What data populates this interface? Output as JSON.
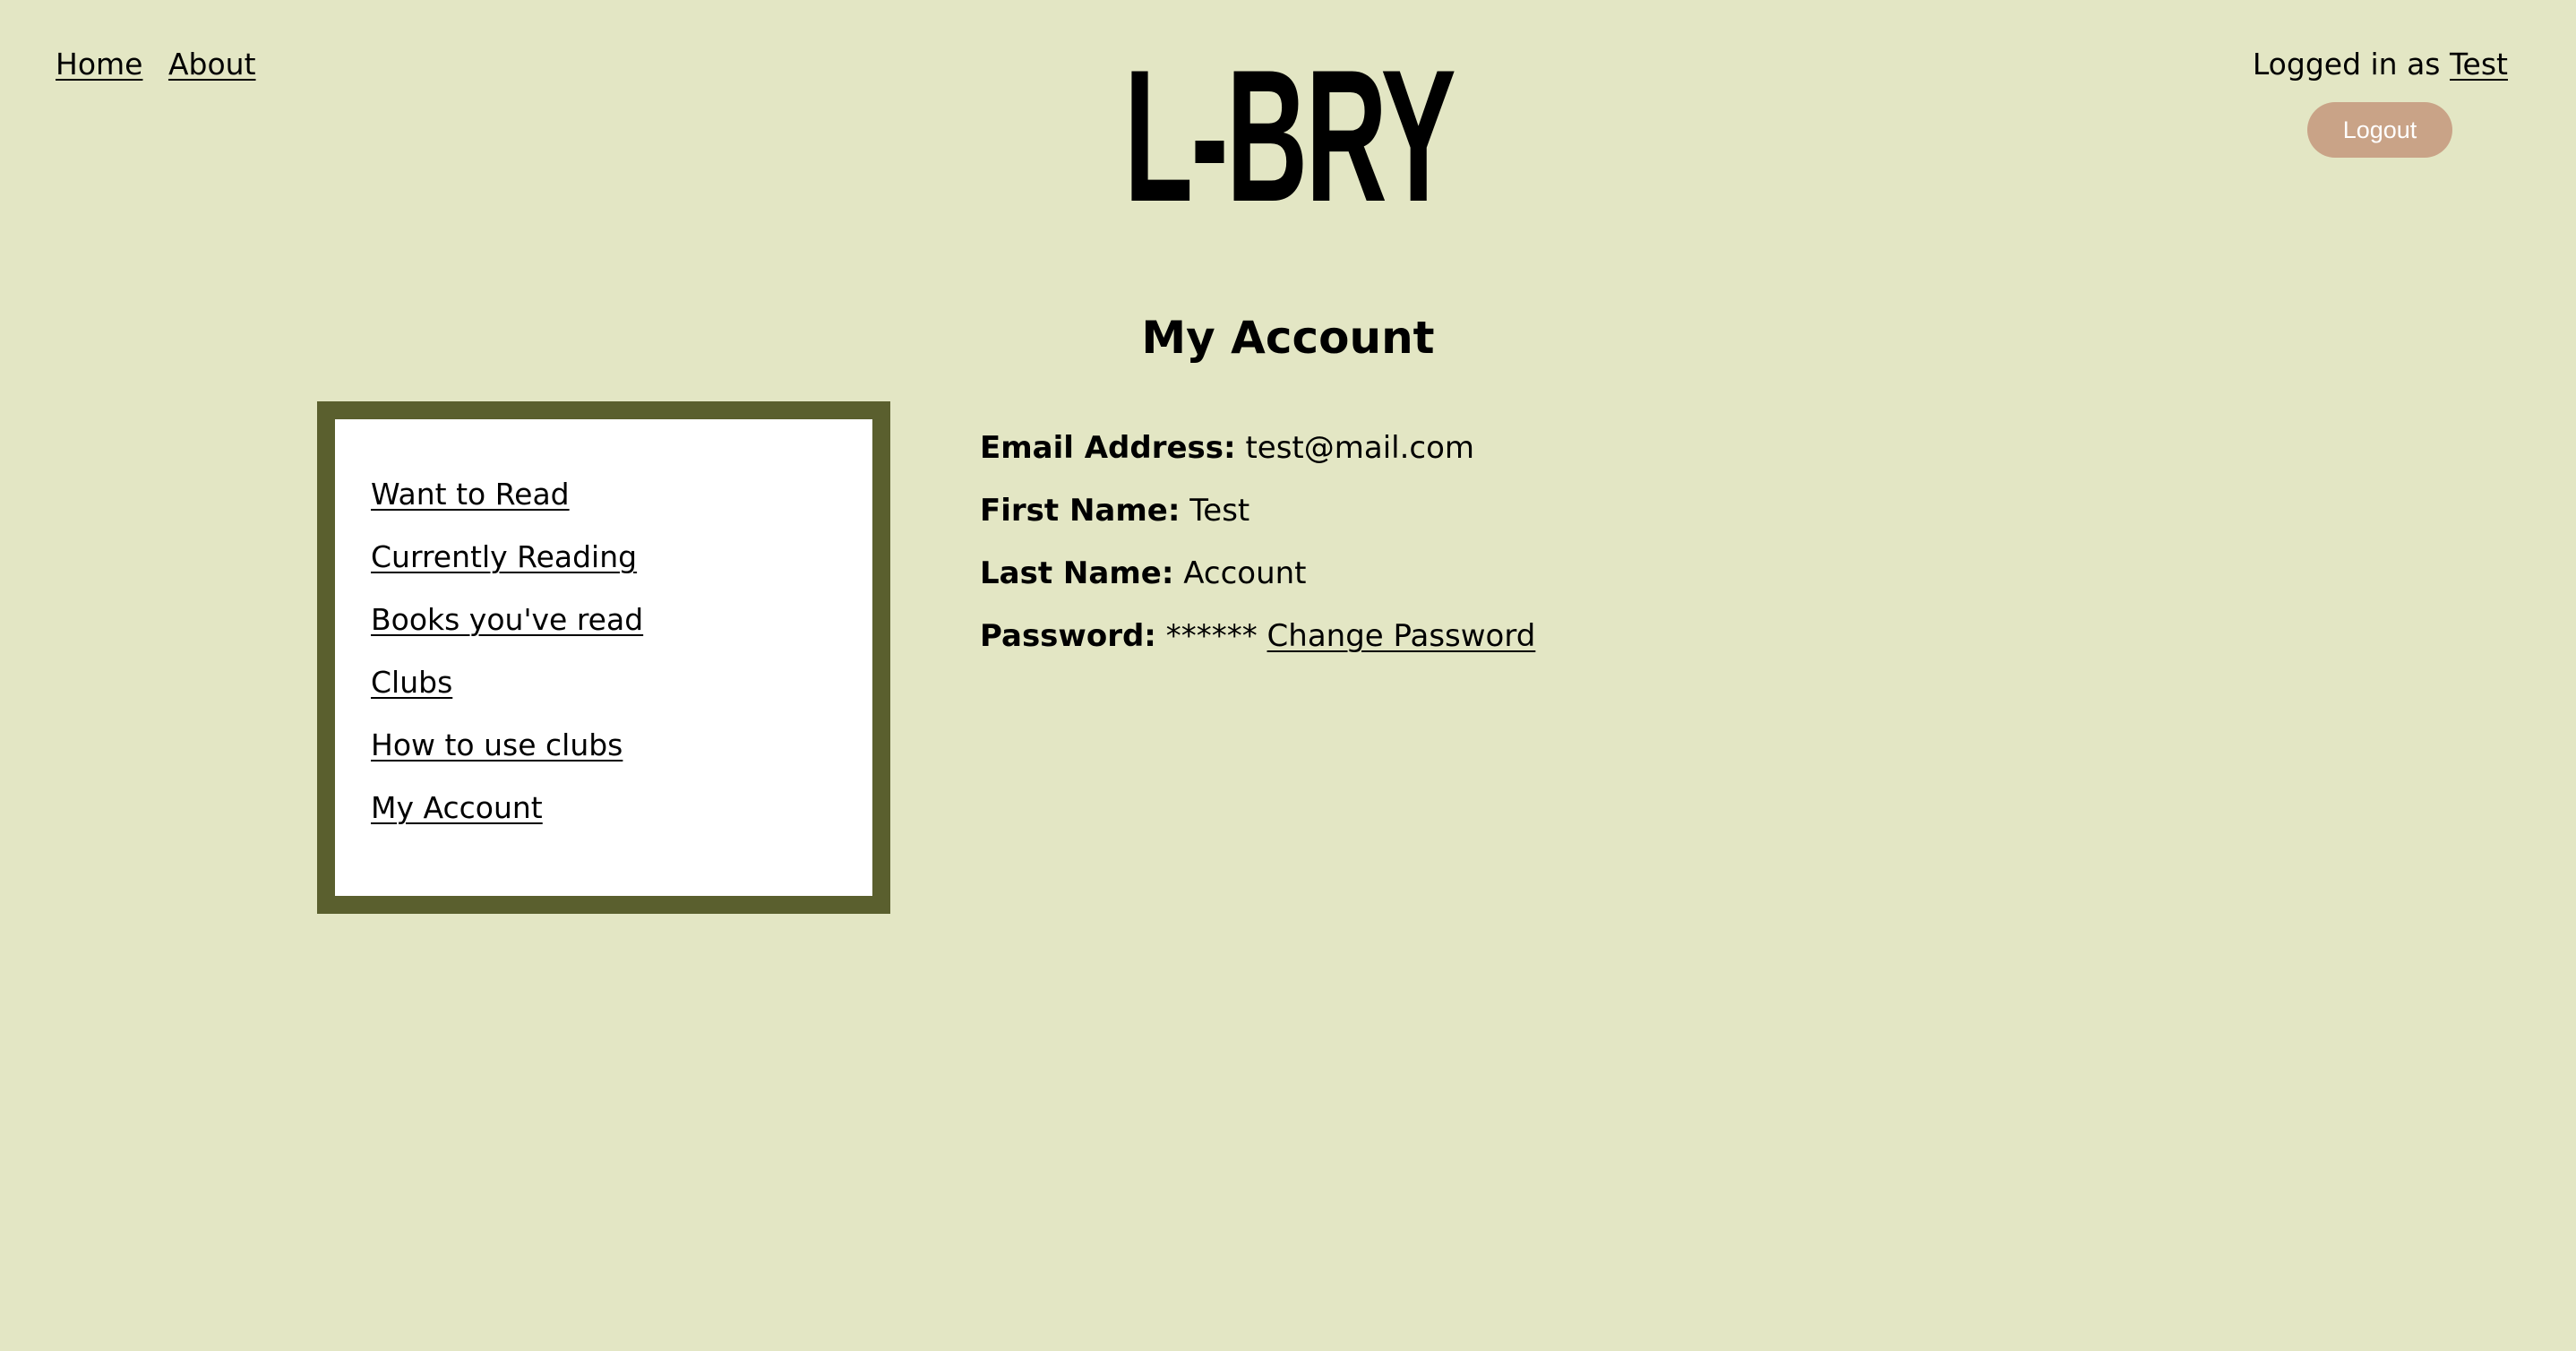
{
  "nav": {
    "home": "Home",
    "about": "About"
  },
  "logo": {
    "text": "L-BRY"
  },
  "user": {
    "prefix": "Logged in as",
    "name": "Test",
    "logout": "Logout"
  },
  "page": {
    "title": "My Account"
  },
  "sidebar": {
    "items": [
      {
        "label": "Want to Read"
      },
      {
        "label": "Currently Reading"
      },
      {
        "label": "Books you've read"
      },
      {
        "label": "Clubs"
      },
      {
        "label": "How to use clubs"
      },
      {
        "label": "My Account"
      }
    ]
  },
  "account": {
    "email_label": "Email Address:",
    "email_value": "test@mail.com",
    "first_label": "First Name:",
    "first_value": "Test",
    "last_label": "Last Name:",
    "last_value": "Account",
    "password_label": "Password:",
    "password_value": "******",
    "change_password": "Change Password"
  },
  "colors": {
    "background": "#e3e6c4",
    "sidebar_border": "#5a5f2e",
    "logout_button": "#c9a387"
  }
}
